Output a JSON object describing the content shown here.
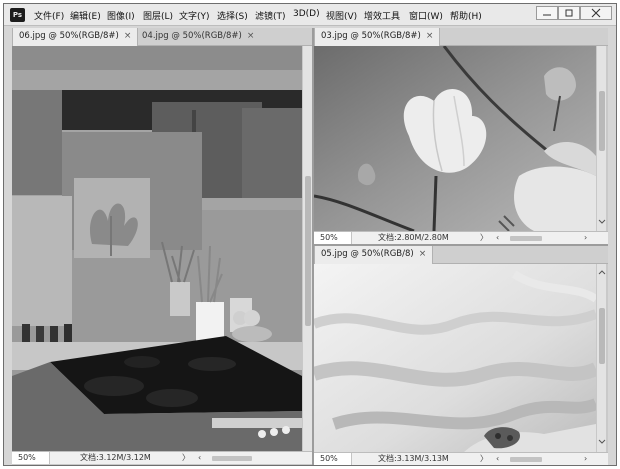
{
  "app": {
    "logo": "Ps"
  },
  "menu": [
    "文件(F)",
    "编辑(E)",
    "图像(I)",
    "图层(L)",
    "文字(Y)",
    "选择(S)",
    "滤镜(T)",
    "3D(D)",
    "视图(V)",
    "增效工具",
    "窗口(W)",
    "帮助(H)"
  ],
  "window_controls": {
    "minimize": "—",
    "restore": "□",
    "close": "✕"
  },
  "left_panel": {
    "tabs": [
      {
        "label": "06.jpg @ 50%(RGB/8#)",
        "close": "×",
        "active": true
      },
      {
        "label": "04.jpg @ 50%(RGB/8#)",
        "close": "×",
        "active": false
      }
    ],
    "image": "kitchen-photo-grayscale",
    "status": {
      "zoom": "50%",
      "doc": "文档:3.12M/3.12M",
      "arrow_right": "〉",
      "arrow_left": "‹"
    }
  },
  "top_right_panel": {
    "tabs": [
      {
        "label": "03.jpg @ 50%(RGB/8#)",
        "close": "×",
        "active": true
      }
    ],
    "image": "magnolia-flowers-grayscale",
    "status": {
      "zoom": "50%",
      "doc": "文档:2.80M/2.80M",
      "arrow_right": "〉",
      "arrow_left": "‹",
      "arrow_end": "›"
    }
  },
  "bottom_right_panel": {
    "tabs": [
      {
        "label": "05.jpg @ 50%(RGB/8)",
        "close": "×",
        "active": true
      }
    ],
    "image": "fabric-closeup-grayscale",
    "status": {
      "zoom": "50%",
      "doc": "文档:3.13M/3.13M",
      "arrow_right": "〉",
      "arrow_left": "‹",
      "arrow_end": "›"
    }
  },
  "icons": {
    "ps_logo": "ps-logo-icon",
    "minimize": "minimize-icon",
    "restore": "restore-icon",
    "close": "close-icon",
    "chevron_up": "chevron-up-icon",
    "chevron_down": "chevron-down-icon"
  }
}
